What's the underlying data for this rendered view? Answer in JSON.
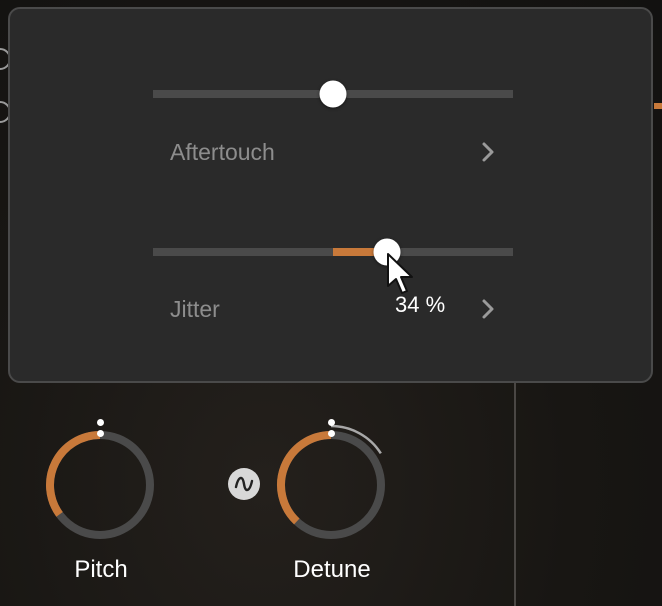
{
  "popup": {
    "aftertouch": {
      "label": "Aftertouch",
      "value": 0.5
    },
    "jitter": {
      "label": "Jitter",
      "value": 0.65,
      "value_text": "34 %"
    }
  },
  "knobs": {
    "pitch": {
      "label": "Pitch",
      "value": 0.35
    },
    "detune": {
      "label": "Detune",
      "value": 0.38,
      "modulation": 0.16
    }
  },
  "colors": {
    "accent": "#c8793a",
    "track": "#4a4a4a",
    "panel": "#2a2a2a"
  },
  "icons": {
    "chevron": "chevron-right-icon",
    "wave": "waveform-icon",
    "cursor": "mouse-pointer-icon"
  }
}
